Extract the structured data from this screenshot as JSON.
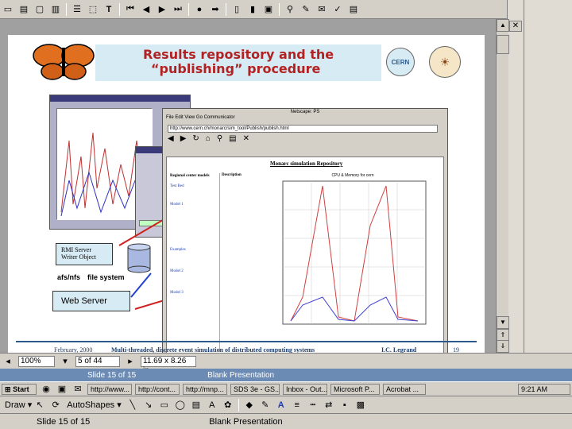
{
  "toolbar": {
    "icons": [
      "copy-icon",
      "paste-icon",
      "new-icon",
      "open-icon",
      "bold-icon",
      "text-icon",
      "first-slide-icon",
      "prev-icon",
      "next-icon",
      "last-slide-icon",
      "record-icon",
      "play-icon",
      "page-icon",
      "page2-icon",
      "frame-icon",
      "find-icon",
      "tools-icon",
      "comment-icon",
      "spell-icon",
      "doc-icon"
    ]
  },
  "slide": {
    "title_line1": "Results repository and the",
    "title_line2": "“publishing” procedure",
    "cern_label": "CERN",
    "rmi_label1": "RMI Server",
    "rmi_label2": "Writer Object",
    "afs_label": "afs/nfs",
    "filesystem_label": "file system",
    "webserver_label": "Web Server",
    "browser": {
      "title": "Netscape: PS",
      "menu": "File  Edit  View  Go  Communicator",
      "url": "http://www.cern.ch/monarc/sim_tool/Publish/publish.html",
      "page_heading": "Monarc simulation Repository",
      "section_regional": "Regional center models",
      "section_testbed": "Test Bed",
      "section_model1": "Model 1",
      "section_examples": "Examples",
      "section_model2": "Model 2",
      "section_model3": "Model 3",
      "desc_heading": "Description",
      "plot_title": "CPU & Memory for cern"
    },
    "footer_date": "February, 2000",
    "footer_title": "Multi-threaded, discrete event simulation  of distributed computing systems",
    "footer_author": "I.C. Legrand",
    "footer_page": "19"
  },
  "zoom_bar": {
    "zoom": "100%",
    "page": "5 of 44",
    "size": "11.69 x 8.26 in"
  },
  "slide_status": {
    "slide": "Slide 15 of 15",
    "design": "Blank Presentation"
  },
  "taskbar": {
    "start": "Start",
    "tasks": [
      "http://www...",
      "http://cont...",
      "http://mnp...",
      "SDS 3e - GS...",
      "Inbox - Out...",
      "Microsoft P...",
      "Acrobat ..."
    ],
    "tray": "9:21 AM"
  },
  "draw_toolbar": {
    "draw_label": "Draw",
    "autoshapes": "AutoShapes"
  },
  "status_bar": {
    "slide": "Slide 15 of 15",
    "design": "Blank Presentation"
  }
}
